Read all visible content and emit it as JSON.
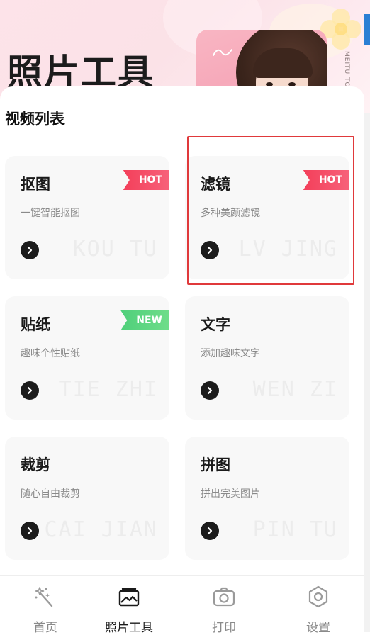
{
  "header": {
    "title": "照片工具",
    "side_text": "MEITU TO"
  },
  "section": {
    "title": "视频列表"
  },
  "cards": [
    {
      "title": "抠图",
      "subtitle": "一键智能抠图",
      "bg_text": "KOU TU",
      "badge": "HOT"
    },
    {
      "title": "滤镜",
      "subtitle": "多种美颜滤镜",
      "bg_text": "LV JING",
      "badge": "HOT"
    },
    {
      "title": "贴纸",
      "subtitle": "趣味个性贴纸",
      "bg_text": "TIE ZHI",
      "badge": "NEW"
    },
    {
      "title": "文字",
      "subtitle": "添加趣味文字",
      "bg_text": "WEN ZI",
      "badge": ""
    },
    {
      "title": "裁剪",
      "subtitle": "随心自由裁剪",
      "bg_text": "CAI JIAN",
      "badge": ""
    },
    {
      "title": "拼图",
      "subtitle": "拼出完美图片",
      "bg_text": "PIN TU",
      "badge": ""
    }
  ],
  "nav": [
    {
      "label": "首页",
      "icon": "magic-wand-icon",
      "active": false
    },
    {
      "label": "照片工具",
      "icon": "image-icon",
      "active": true
    },
    {
      "label": "打印",
      "icon": "camera-icon",
      "active": false
    },
    {
      "label": "设置",
      "icon": "hexagon-settings-icon",
      "active": false
    }
  ],
  "colors": {
    "hot_badge": "#f33f5a",
    "new_badge": "#4fcf7a",
    "highlight_border": "#e0393b",
    "active_nav": "#1a1a1a",
    "inactive_nav": "#8a8a8a"
  }
}
